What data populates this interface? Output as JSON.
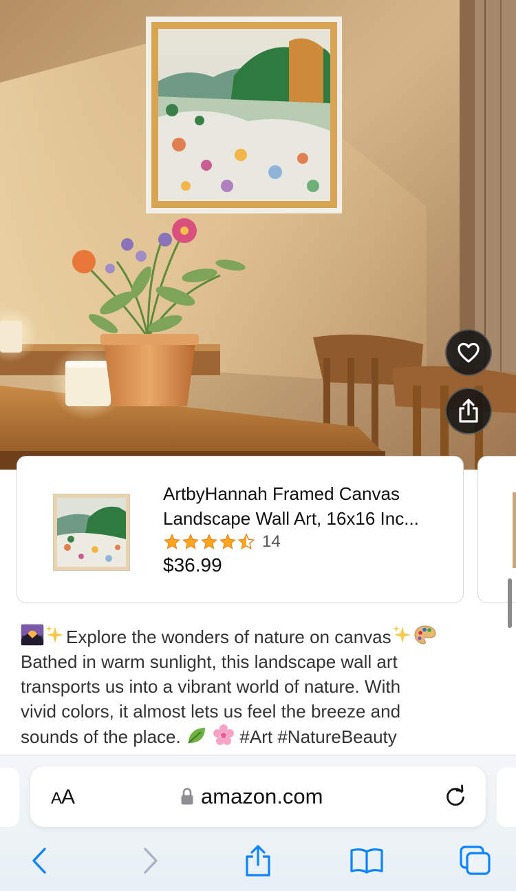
{
  "product": {
    "title_line1": "ArtbyHannah Framed Canvas",
    "title_line2": "Landscape Wall Art, 16x16 Inc...",
    "rating": 4.5,
    "rating_count": "14",
    "price": "$36.99"
  },
  "description": {
    "line1": "Explore the wonders of nature on canvas",
    "line2": "Bathed in warm sunlight, this landscape wall art",
    "line3": "transports us into a vibrant world of nature. With",
    "line4": "vivid colors, it almost lets us feel the breeze and",
    "line5_text": "sounds of the place.",
    "line5_tags": "#Art #NatureBeauty"
  },
  "browser": {
    "text_size_label_large": "A",
    "text_size_label_small": "A",
    "url": "amazon.com"
  },
  "icons": {
    "favorite": "heart-icon",
    "share": "share-icon",
    "lock": "lock-icon",
    "reload": "reload-icon",
    "back": "chevron-left-icon",
    "forward": "chevron-right-icon",
    "bookmarks": "book-icon",
    "tabs": "tabs-icon"
  },
  "colors": {
    "star": "#ffa41c",
    "accent_blue": "#0a84ff",
    "text_primary": "#0f1111",
    "text_secondary": "#565959"
  }
}
